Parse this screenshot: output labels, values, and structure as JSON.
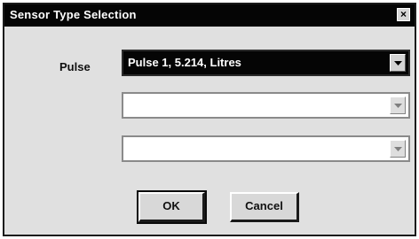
{
  "window": {
    "title": "Sensor Type Selection",
    "close_glyph": "×"
  },
  "form": {
    "label": "Pulse",
    "combos": [
      {
        "value": "Pulse 1, 5.214, Litres",
        "state": "selected"
      },
      {
        "value": "",
        "state": "empty"
      },
      {
        "value": "",
        "state": "empty"
      }
    ]
  },
  "buttons": {
    "ok_label": "OK",
    "cancel_label": "Cancel"
  }
}
